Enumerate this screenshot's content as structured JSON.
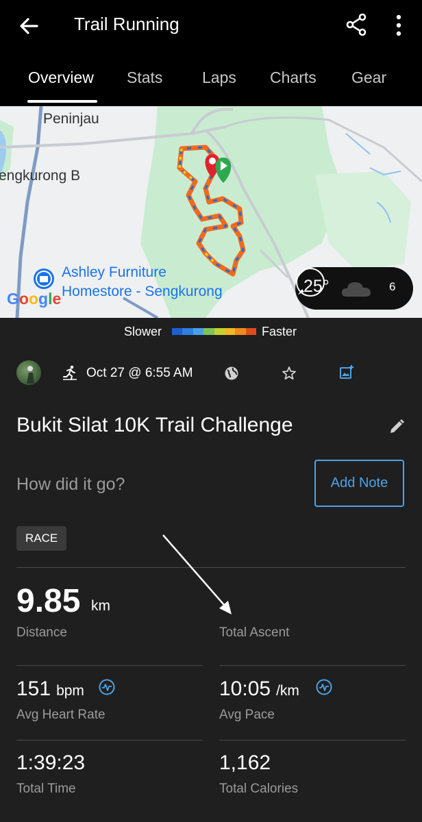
{
  "header": {
    "title": "Trail Running",
    "tabs": [
      "Overview",
      "Stats",
      "Laps",
      "Charts",
      "Gear"
    ]
  },
  "map": {
    "labels": [
      "Peninjau",
      "engkurong B"
    ],
    "poi": [
      "Ashley Furniture",
      "Homestore - Sengkurong"
    ],
    "google_logo": "Google",
    "weather": {
      "temperature": "25°",
      "wind_speed": "6"
    }
  },
  "legend": {
    "left": "Slower",
    "right": "Faster",
    "colors": [
      "#1f5fd0",
      "#2f7ee0",
      "#4aa0e8",
      "#7fc25a",
      "#c5d22f",
      "#f0b923",
      "#f08a1e",
      "#e24b1b"
    ]
  },
  "meta": {
    "date": "Oct 27 @ 6:55 AM"
  },
  "activity": {
    "name": "Bukit Silat 10K Trail Challenge",
    "note_placeholder": "How did it go?",
    "add_note": "Add Note",
    "badge": "RACE"
  },
  "stats": {
    "distance": {
      "value": "9.85",
      "unit": "km",
      "label": "Distance"
    },
    "total_ascent": {
      "label": "Total Ascent"
    },
    "avg_hr": {
      "value": "151",
      "unit": "bpm",
      "label": "Avg Heart Rate"
    },
    "avg_pace": {
      "value": "10:05",
      "unit": "/km",
      "label": "Avg Pace"
    },
    "total_time": {
      "value": "1:39:23",
      "label": "Total Time"
    },
    "total_calories": {
      "value": "1,162",
      "label": "Total Calories"
    }
  }
}
